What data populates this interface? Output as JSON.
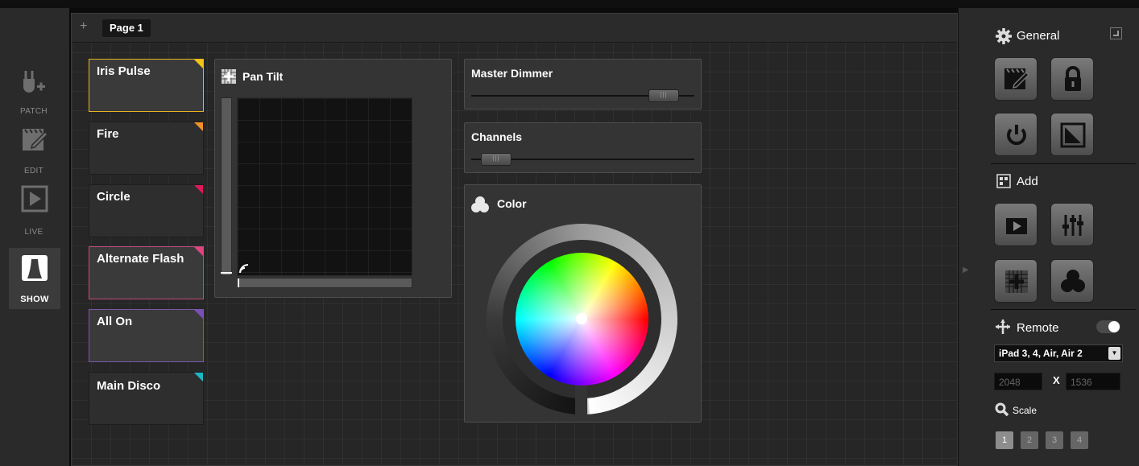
{
  "rail": {
    "patch": "PATCH",
    "edit": "EDIT",
    "live": "LIVE",
    "show": "SHOW"
  },
  "page": {
    "tab_label": "Page 1",
    "add_symbol": "+"
  },
  "scenes": [
    {
      "name": "Iris Pulse",
      "corner_color": "#f2c318",
      "border_color": "#e6b520"
    },
    {
      "name": "Fire",
      "corner_color": "#f0912a",
      "border_color": ""
    },
    {
      "name": "Circle",
      "corner_color": "#e0185c",
      "border_color": ""
    },
    {
      "name": "Alternate Flash",
      "corner_color": "#e0457f",
      "border_color": "#c04b80"
    },
    {
      "name": "All On",
      "corner_color": "#7b4fb8",
      "border_color": "#7a57a8"
    },
    {
      "name": "Main Disco",
      "corner_color": "#19b9c4",
      "border_color": ""
    }
  ],
  "widgets": {
    "pan_tilt": {
      "title": "Pan Tilt"
    },
    "master_dimmer": {
      "title": "Master Dimmer",
      "value": 0.92
    },
    "channels": {
      "title": "Channels",
      "value": 0.05
    },
    "color": {
      "title": "Color",
      "icon_text": "R G B"
    }
  },
  "side": {
    "general": "General",
    "add": "Add",
    "remote": "Remote",
    "remote_toggle_on": true,
    "device": "iPad 3, 4, Air, Air 2",
    "width": "2048",
    "x_label": "X",
    "height": "1536",
    "scale": "Scale",
    "scale_options": [
      "1",
      "2",
      "3",
      "4"
    ],
    "scale_selected": "1"
  }
}
